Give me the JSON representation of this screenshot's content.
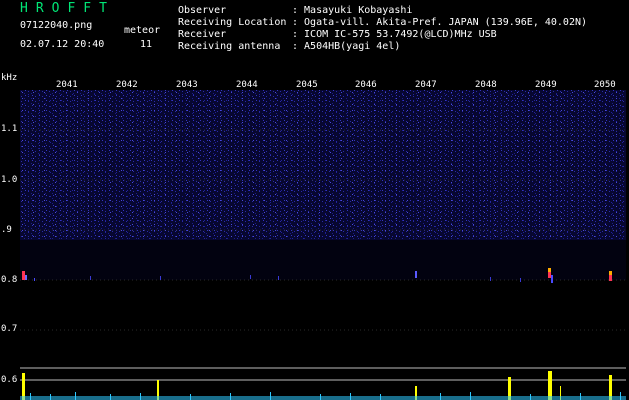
{
  "header": {
    "title": "HROFFT",
    "filename": "07122040.png",
    "timestamp": "02.07.12 20:40",
    "meteor_label": "meteor",
    "meteor_count": "11",
    "fields": [
      {
        "label": "Observer",
        "value": ": Masayuki Kobayashi"
      },
      {
        "label": "Receiving Location",
        "value": ": Ogata-vill. Akita-Pref. JAPAN (139.96E, 40.02N)"
      },
      {
        "label": "Receiver",
        "value": ": ICOM IC-575 53.7492(@LCD)MHz USB"
      },
      {
        "label": "Receiving antenna",
        "value": ": A504HB(yagi 4el)"
      }
    ]
  },
  "axis": {
    "unit": "kHz",
    "y_ticks": [
      "1.1",
      "1.0",
      ".9",
      "0.8",
      "0.7",
      "0.6"
    ],
    "x_ticks": [
      "2041",
      "2042",
      "2043",
      "2044",
      "2045",
      "2046",
      "2047",
      "2048",
      "2049",
      "2050"
    ]
  },
  "colors": {
    "background": "#000000",
    "noise": "#12126e",
    "signal": "#ffff00",
    "title": "#00e676"
  }
}
